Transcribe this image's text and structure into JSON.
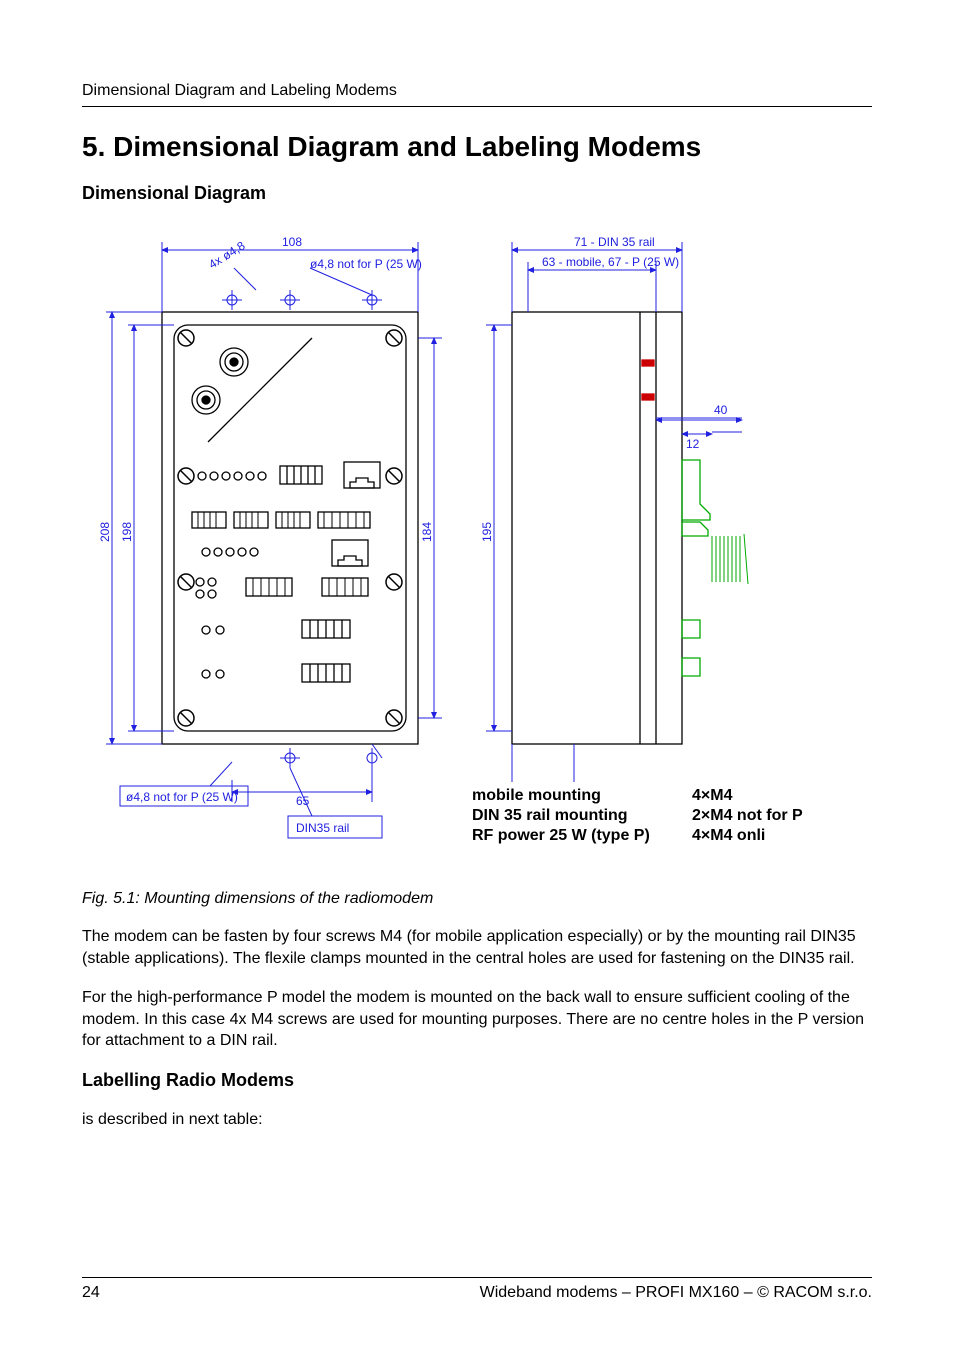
{
  "header": {
    "running_head": "Dimensional Diagram and Labeling Modems"
  },
  "title": "5. Dimensional Diagram and Labeling Modems",
  "sections": {
    "dim_heading": "Dimensional Diagram",
    "label_heading": "Labelling Radio Modems"
  },
  "figure": {
    "caption": "Fig. 5.1: Mounting dimensions of the radiomodem",
    "dims": {
      "top_width": "108",
      "hole_spec": "ø4,8 not for P (25 W)",
      "hole_spec_bl": "ø4,8 not for P (25 W)",
      "diag_hole": "4x ø4,8",
      "left_outer_h": "208",
      "left_inner_h": "198",
      "right_inner_h": "184",
      "side_h": "195",
      "side_top_w": "71 - DIN 35 rail",
      "side_sub_w": "63 - mobile, 67 - P (25 W)",
      "side_offset": "40",
      "side_inset": "12",
      "bottom_gap": "65",
      "rail_label": "DIN35   rail"
    },
    "mount_table": {
      "r1c1": "mobile mounting",
      "r1c2": "4×M4",
      "r2c1": "DIN 35 rail mounting",
      "r2c2": "2×M4 not for P",
      "r3c1": "RF power 25 W (type P)",
      "r3c2": "4×M4 onli"
    }
  },
  "paragraphs": {
    "p1": "The modem can be fasten by four screws M4 (for mobile application especially) or by the mounting rail DIN35 (stable applications). The flexile clamps mounted in the central holes are used for fastening on the DIN35 rail.",
    "p2": "For the high-performance P model the modem is mounted on the back wall to ensure sufficient cooling of the modem. In this case 4x M4 screws are used for mounting purposes. There are no centre holes in the P version for attachment to a DIN rail.",
    "p3": "is described in next table:"
  },
  "footer": {
    "page_no": "24",
    "doc_line": "Wideband modems – PROFI MX160 – © RACOM s.r.o."
  }
}
